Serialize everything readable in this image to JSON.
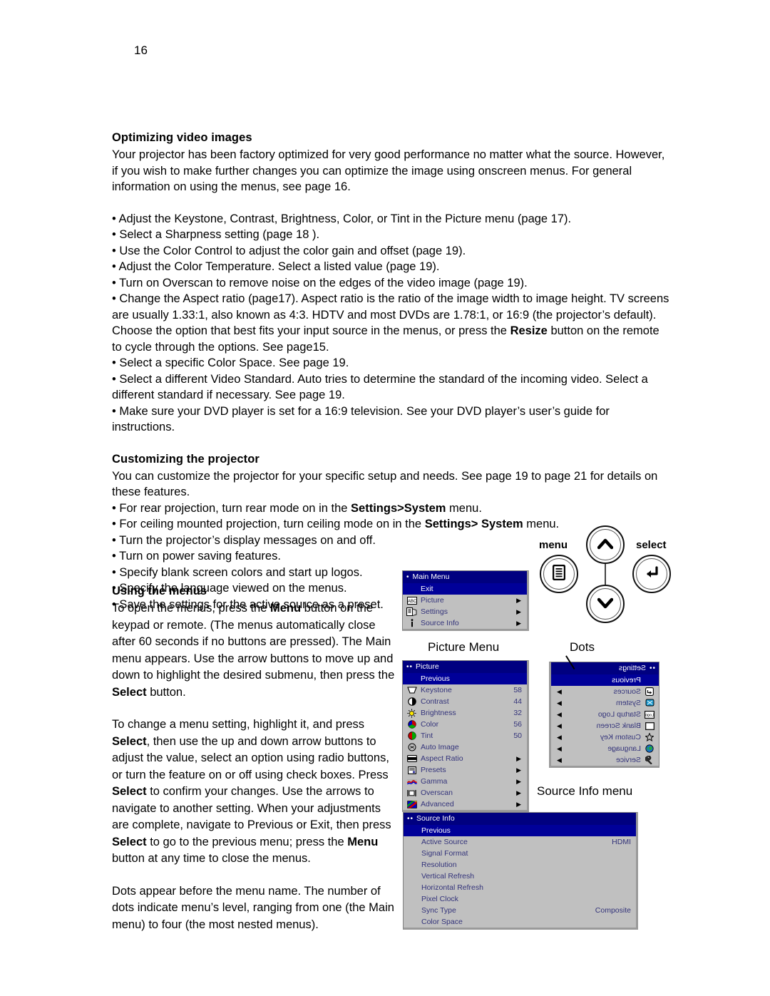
{
  "page": {
    "number": "16"
  },
  "sections": {
    "optimizing": {
      "heading": "Optimizing video images",
      "intro": "Your projector has been factory optimized for very good performance no matter what the source. However, if you wish to make further changes you can optimize the image using onscreen menus. For general information on using the menus, see page 16.",
      "bullets": [
        "• Adjust the Keystone, Contrast, Brightness, Color, or Tint in the Picture menu (page 17).",
        "• Select a Sharpness setting (page 18 ).",
        "• Use the Color Control to adjust the color gain and offset (page 19).",
        "• Adjust the Color Temperature. Select a listed value (page 19).",
        "• Turn on Overscan to remove noise on the edges of the video image (page 19).",
        "• Select a specific Color Space. See page 19.",
        "• Select a different Video Standard. Auto tries to determine the standard of the incoming video. Select a different standard if necessary. See page 19.",
        "• Make sure your DVD player is set for a 16:9 television. See your DVD player’s user’s guide for instructions."
      ],
      "aspect_bullet_pre": "• Change the Aspect ratio (page17). Aspect ratio is the ratio of the image width to image height. TV screens are usually 1.33:1, also known as 4:3. HDTV and most DVDs are 1.78:1, or 16:9 (the projector’s default). Choose the option that best fits your input source in the menus, or press the ",
      "aspect_bullet_bold": "Resize",
      "aspect_bullet_post": " button on the remote to cycle through the options. See page15."
    },
    "customizing": {
      "heading": "Customizing the projector",
      "intro": "You can customize the projector for your specific setup and needs. See page 19 to page 21 for details on these features.",
      "bullet_rear_pre": "• For rear projection, turn rear mode on in the ",
      "bullet_rear_bold": "Settings>System",
      "bullet_rear_post": " menu.",
      "bullet_ceiling_pre": "• For ceiling mounted projection, turn ceiling mode on in the ",
      "bullet_ceiling_bold": "Settings> System",
      "bullet_ceiling_post": " menu.",
      "bullets": [
        "• Turn the projector’s display messages on and off.",
        "• Turn on power saving features.",
        "• Specify blank screen colors and start up logos.",
        "• Specify the language viewed on the menus.",
        "• Save the settings for the active source as a preset."
      ]
    },
    "using_menus": {
      "heading": "Using the menus",
      "para1_a": "To open the menus, press the ",
      "para1_bold1": "Menu",
      "para1_b": " button on the keypad or remote. (The menus automatically close after 60 seconds if no buttons are pressed). The Main menu appears. Use the arrow buttons to move up and down to highlight the desired submenu, then press the ",
      "para1_bold2": "Select",
      "para1_c": " button.",
      "para2_a": "To change a menu setting, highlight it, and press ",
      "para2_bold1": "Select",
      "para2_b": ", then use the up and down arrow buttons to adjust the value, select an option using radio buttons, or turn the feature on or off using check boxes. Press ",
      "para2_bold2": "Select",
      "para2_c": " to confirm your changes. Use the arrows to navigate to another setting. When your adjustments are complete, navigate to Previous or Exit, then press ",
      "para2_bold3": "Select",
      "para2_d": " to go to the previous menu; press the ",
      "para2_bold4": "Menu",
      "para2_e": " button at any time to close the menus.",
      "para3": "Dots appear before the menu name. The number of dots indicate menu’s level, ranging from one (the Main menu) to four (the most nested menus)."
    }
  },
  "keypad": {
    "menu_label": "menu",
    "select_label": "select",
    "up_glyph": "▲",
    "down_glyph": "▼",
    "select_glyph": "↵",
    "menu_glyph": "☰"
  },
  "callouts": {
    "picture_menu": "Picture Menu",
    "dots": "Dots",
    "source_info_menu": "Source Info menu"
  },
  "osd": {
    "main_menu": {
      "dots": "•",
      "title": "Main Menu",
      "rows": [
        {
          "label": "Exit",
          "icon": "",
          "value": "",
          "arrow": "",
          "selected": true,
          "indent": true
        },
        {
          "label": "Picture",
          "icon": "picture-icon",
          "value": "",
          "arrow": "▶",
          "selected": false
        },
        {
          "label": "Settings",
          "icon": "settings-icon",
          "value": "",
          "arrow": "▶",
          "selected": false
        },
        {
          "label": "Source Info",
          "icon": "info-icon",
          "value": "",
          "arrow": "▶",
          "selected": false
        }
      ]
    },
    "picture_menu": {
      "dots": "••",
      "title": "Picture",
      "rows": [
        {
          "label": "Previous",
          "icon": "",
          "value": "",
          "arrow": "",
          "selected": true,
          "indent": true
        },
        {
          "label": "Keystone",
          "icon": "keystone-icon",
          "value": "58",
          "arrow": "",
          "selected": false
        },
        {
          "label": "Contrast",
          "icon": "contrast-icon",
          "value": "44",
          "arrow": "",
          "selected": false
        },
        {
          "label": "Brightness",
          "icon": "brightness-icon",
          "value": "32",
          "arrow": "",
          "selected": false
        },
        {
          "label": "Color",
          "icon": "color-icon",
          "value": "56",
          "arrow": "",
          "selected": false
        },
        {
          "label": "Tint",
          "icon": "tint-icon",
          "value": "50",
          "arrow": "",
          "selected": false
        },
        {
          "label": "Auto Image",
          "icon": "auto-image-icon",
          "value": "",
          "arrow": "",
          "selected": false
        },
        {
          "label": "Aspect Ratio",
          "icon": "aspect-ratio-icon",
          "value": "",
          "arrow": "▶",
          "selected": false
        },
        {
          "label": "Presets",
          "icon": "presets-icon",
          "value": "",
          "arrow": "▶",
          "selected": false
        },
        {
          "label": "Gamma",
          "icon": "gamma-icon",
          "value": "",
          "arrow": "▶",
          "selected": false
        },
        {
          "label": "Overscan",
          "icon": "overscan-icon",
          "value": "",
          "arrow": "▶",
          "selected": false
        },
        {
          "label": "Advanced",
          "icon": "advanced-icon",
          "value": "",
          "arrow": "▶",
          "selected": false
        }
      ]
    },
    "settings_menu": {
      "dots": "••",
      "title": "Settings",
      "rows": [
        {
          "label": "Previous",
          "icon": "",
          "value": "",
          "arrow": "",
          "selected": true,
          "indent": true
        },
        {
          "label": "Sources",
          "icon": "sources-icon",
          "value": "",
          "arrow": "▶",
          "selected": false
        },
        {
          "label": "System",
          "icon": "system-icon",
          "value": "",
          "arrow": "▶",
          "selected": false
        },
        {
          "label": "Startup Logo",
          "icon": "startup-logo-icon",
          "value": "",
          "arrow": "▶",
          "selected": false
        },
        {
          "label": "Blank Screen",
          "icon": "blank-screen-icon",
          "value": "",
          "arrow": "▶",
          "selected": false
        },
        {
          "label": "Custom Key",
          "icon": "custom-key-icon",
          "value": "",
          "arrow": "▶",
          "selected": false
        },
        {
          "label": "Language",
          "icon": "language-icon",
          "value": "",
          "arrow": "▶",
          "selected": false
        },
        {
          "label": "Service",
          "icon": "service-icon",
          "value": "",
          "arrow": "▶",
          "selected": false
        }
      ]
    },
    "source_info_menu": {
      "dots": "••",
      "title": "Source Info",
      "rows": [
        {
          "label": "Previous",
          "icon": "",
          "value": "",
          "arrow": "",
          "selected": true,
          "indent": true
        },
        {
          "label": "Active Source",
          "icon": "",
          "value": "HDMI",
          "arrow": "",
          "selected": false,
          "indent": true
        },
        {
          "label": "Signal Format",
          "icon": "",
          "value": "",
          "arrow": "",
          "selected": false,
          "indent": true
        },
        {
          "label": "Resolution",
          "icon": "",
          "value": "",
          "arrow": "",
          "selected": false,
          "indent": true
        },
        {
          "label": "Vertical Refresh",
          "icon": "",
          "value": "",
          "arrow": "",
          "selected": false,
          "indent": true
        },
        {
          "label": "Horizontal Refresh",
          "icon": "",
          "value": "",
          "arrow": "",
          "selected": false,
          "indent": true
        },
        {
          "label": "Pixel Clock",
          "icon": "",
          "value": "",
          "arrow": "",
          "selected": false,
          "indent": true
        },
        {
          "label": "Sync Type",
          "icon": "",
          "value": "Composite",
          "arrow": "",
          "selected": false,
          "indent": true
        },
        {
          "label": "Color Space",
          "icon": "",
          "value": "",
          "arrow": "",
          "selected": false,
          "indent": true
        }
      ]
    }
  },
  "colors": {
    "osd_background": "#c0c0c0",
    "osd_title_bar": "#000080",
    "osd_selected": "#000099",
    "osd_text": "#33337a",
    "page_background": "#ffffff",
    "body_text": "#000000"
  }
}
